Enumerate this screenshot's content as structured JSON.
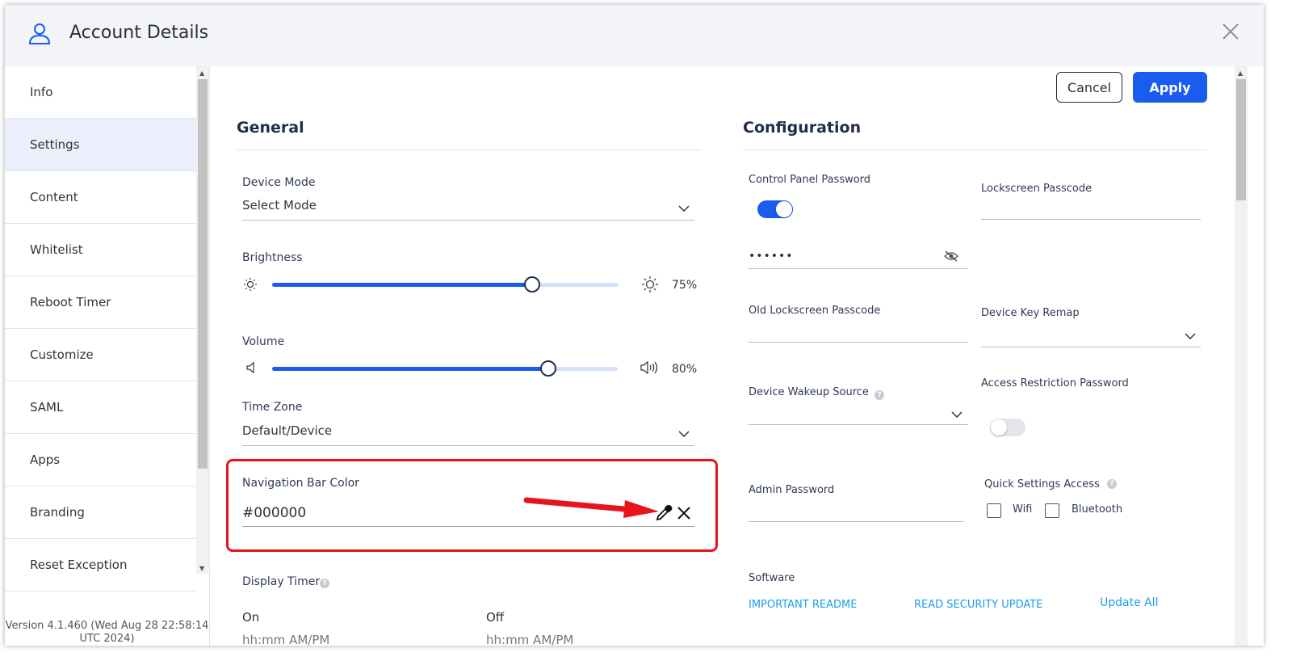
{
  "header": {
    "title": "Account Details"
  },
  "sidebar": {
    "items": [
      {
        "label": "Info"
      },
      {
        "label": "Settings"
      },
      {
        "label": "Content"
      },
      {
        "label": "Whitelist"
      },
      {
        "label": "Reboot Timer"
      },
      {
        "label": "Customize"
      },
      {
        "label": "SAML"
      },
      {
        "label": "Apps"
      },
      {
        "label": "Branding"
      },
      {
        "label": "Reset Exception"
      }
    ],
    "active": "Settings",
    "version": "Version 4.1.460 (Wed Aug 28 22:58:14 UTC 2024)"
  },
  "actions": {
    "cancel": "Cancel",
    "apply": "Apply"
  },
  "general": {
    "title": "General",
    "device_mode": {
      "label": "Device Mode",
      "value": "Select Mode"
    },
    "brightness": {
      "label": "Brightness",
      "percent": 75,
      "display": "75%"
    },
    "volume": {
      "label": "Volume",
      "percent": 80,
      "display": "80%"
    },
    "time_zone": {
      "label": "Time Zone",
      "value": "Default/Device"
    },
    "nav_bar_color": {
      "label": "Navigation Bar Color",
      "value": "#000000"
    },
    "display_timer": {
      "label": "Display Timer",
      "on_label": "On",
      "off_label": "Off",
      "on_placeholder": "hh:mm AM/PM",
      "off_placeholder": "hh:mm AM/PM"
    }
  },
  "configuration": {
    "title": "Configuration",
    "control_panel_password": {
      "label": "Control Panel Password",
      "enabled": true,
      "value": "••••••"
    },
    "lockscreen_passcode": {
      "label": "Lockscreen Passcode",
      "value": ""
    },
    "old_lockscreen_passcode": {
      "label": "Old Lockscreen Passcode",
      "value": ""
    },
    "device_key_remap": {
      "label": "Device Key Remap",
      "value": ""
    },
    "device_wakeup_source": {
      "label": "Device Wakeup Source",
      "value": ""
    },
    "access_restriction_password": {
      "label": "Access Restriction Password",
      "enabled": false
    },
    "admin_password": {
      "label": "Admin Password",
      "value": ""
    },
    "quick_settings_access": {
      "label": "Quick Settings Access",
      "options": [
        {
          "label": "Wifi",
          "checked": false
        },
        {
          "label": "Bluetooth",
          "checked": false
        }
      ]
    },
    "software": {
      "label": "Software",
      "links": [
        "IMPORTANT README",
        "READ SECURITY UPDATE"
      ],
      "update_all": "Update All"
    }
  },
  "colors": {
    "accent": "#1a5cf0",
    "highlight": "#e8141b",
    "link": "#1a9ee8"
  }
}
